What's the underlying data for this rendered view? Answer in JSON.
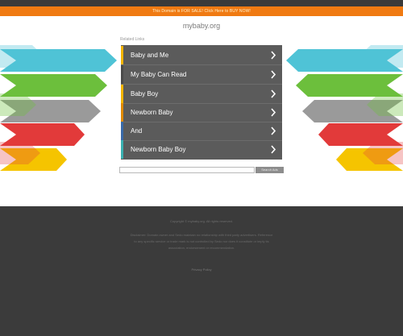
{
  "banner": {
    "text": "This Domain is FOR SALE! Click Here to BUY NOW!"
  },
  "site": {
    "domain": "mybaby.org"
  },
  "related_links_label": "Related Links",
  "links": [
    {
      "label": "Baby and Me",
      "edge_color": "#f5b400"
    },
    {
      "label": "My Baby Can Read",
      "edge_color": "#4a4a4a"
    },
    {
      "label": "Baby Boy",
      "edge_color": "#f5b400"
    },
    {
      "label": "Newborn Baby",
      "edge_color": "#e08a00"
    },
    {
      "label": "And",
      "edge_color": "#3a6aa8"
    },
    {
      "label": "Newborn Baby Boy",
      "edge_color": "#3ab0b0"
    }
  ],
  "search": {
    "placeholder": "",
    "button_label": "Search Ads"
  },
  "footer": {
    "copyright": "Copyright © mybaby.org. All rights reserved.",
    "disclaimer": "Disclaimer: Domain owner and Sedo maintain no relationship with third party advertisers. Reference to any specific service or trade mark is not controlled by Sedo nor does it constitute or imply its association, endorsement or recommendation.",
    "privacy": "Privacy Policy"
  },
  "colors": {
    "arrow_row_1": "#4fc3d6",
    "arrow_row_2": "#6cbf3c",
    "arrow_row_3": "#9a9a9a",
    "arrow_row_4": "#e23a3a",
    "arrow_row_5": "#f5c400",
    "banner": "#f07a12",
    "footer": "#3b3b3b"
  },
  "icons": {
    "link_chevron": "chevron-right-icon"
  }
}
